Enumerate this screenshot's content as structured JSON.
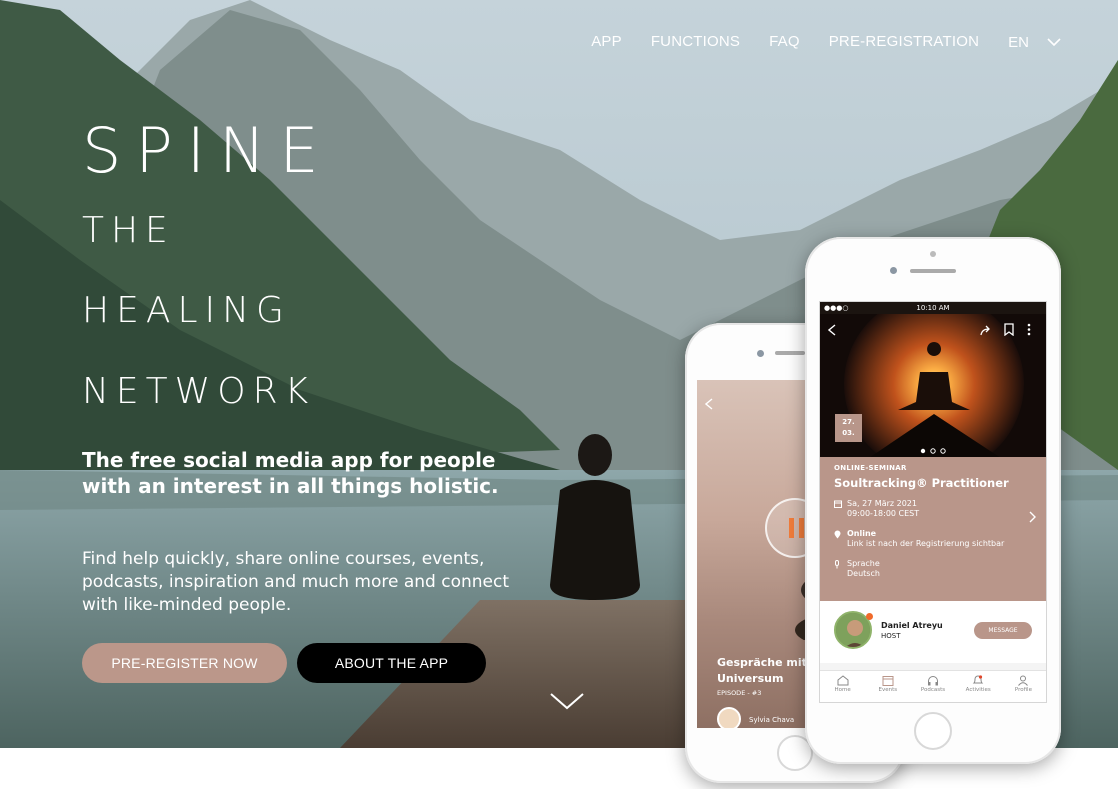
{
  "nav": {
    "items": [
      "APP",
      "FUNCTIONS",
      "FAQ",
      "PRE-REGISTRATION"
    ],
    "language": "EN"
  },
  "hero": {
    "brand": "SPINE",
    "line1": "THE",
    "line2": "HEALING",
    "line3": "NETWORK",
    "subhead": "The free social media app for people with an interest in all things holistic.",
    "description": "Find help quickly,  share online courses, events, podcasts, inspiration and much more and connect with like-minded people.",
    "btn_preregister": "PRE-REGISTER NOW",
    "btn_about": "ABOUT THE APP"
  },
  "phone_front": {
    "time": "10:10 AM",
    "date_day": "27.",
    "date_month": "03.",
    "kicker": "ONLINE-SEMINAR",
    "title": "Soultracking® Practitioner",
    "date_line": "Sa, 27 März 2021",
    "time_line": "09:00-18:00 CEST",
    "location": "Online",
    "location_note": "Link ist nach der Registrierung sichtbar",
    "language_label": "Sprache",
    "language_value": "Deutsch",
    "host_name": "Daniel Atreyu",
    "host_role": "HOST",
    "message_label": "MESSAGE",
    "tabs": [
      "Home",
      "Events",
      "Podcasts",
      "Activities",
      "Profile"
    ]
  },
  "phone_back": {
    "title_line1": "Gespräche mit",
    "title_line2": "Universum",
    "episode": "EPISODE - #3",
    "author": "Sylvia Chava"
  },
  "colors": {
    "accent": "#bb978a",
    "dark_button": "#000000"
  }
}
